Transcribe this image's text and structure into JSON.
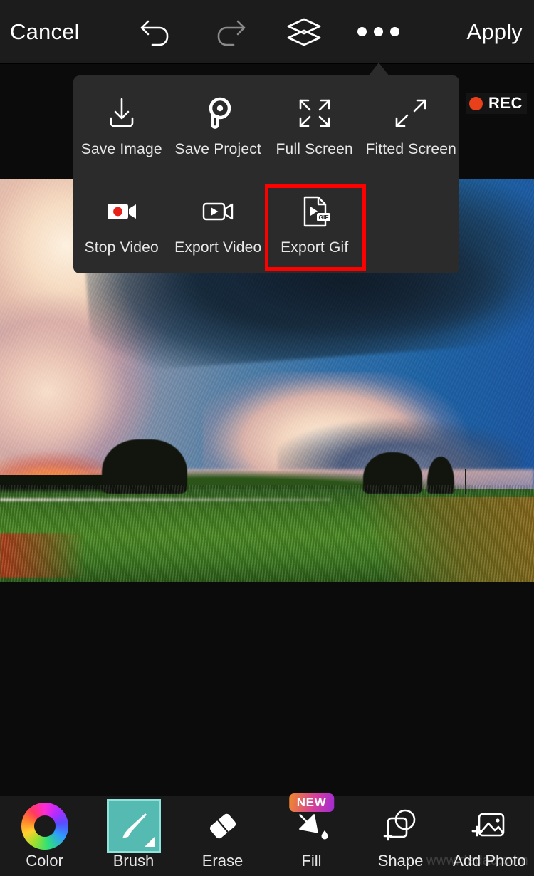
{
  "topbar": {
    "cancel_label": "Cancel",
    "apply_label": "Apply",
    "undo_icon": "undo-arrow-icon",
    "redo_icon": "redo-arrow-icon",
    "layers_icon": "layers-icon",
    "more_icon": "more-options-icon"
  },
  "rec": {
    "label": "REC",
    "dot_color": "#e8401a"
  },
  "menu": {
    "rows": [
      {
        "items": [
          {
            "label": "Save Image",
            "icon": "download-icon"
          },
          {
            "label": "Save Project",
            "icon": "picsart-logo-icon"
          },
          {
            "label": "Full Screen",
            "icon": "full-screen-icon"
          },
          {
            "label": "Fitted Screen",
            "icon": "fitted-screen-icon"
          }
        ]
      },
      {
        "items": [
          {
            "label": "Stop Video",
            "icon": "stop-video-icon"
          },
          {
            "label": "Export Video",
            "icon": "export-video-icon"
          },
          {
            "label": "Export Gif",
            "icon": "export-gif-icon"
          }
        ]
      }
    ],
    "highlight": {
      "target": "Export Gif",
      "color": "#ff0000"
    }
  },
  "toolbar": {
    "tools": [
      {
        "label": "Color",
        "icon": "color-wheel-icon",
        "selected": false,
        "badge": ""
      },
      {
        "label": "Brush",
        "icon": "brush-icon",
        "selected": true,
        "badge": ""
      },
      {
        "label": "Erase",
        "icon": "eraser-icon",
        "selected": false,
        "badge": ""
      },
      {
        "label": "Fill",
        "icon": "paint-bucket-icon",
        "selected": false,
        "badge": "NEW"
      },
      {
        "label": "Shape",
        "icon": "add-shape-icon",
        "selected": false,
        "badge": ""
      },
      {
        "label": "Add Photo",
        "icon": "add-photo-icon",
        "selected": false,
        "badge": ""
      }
    ],
    "selected_color": "#55bab1",
    "selected_border_color": "#8fe3da"
  },
  "canvas": {
    "artwork_description": "Stylized painterly landscape photo with dramatic storm clouds, sunset glow and green field"
  },
  "watermark": {
    "text": "www.dedaq.com"
  }
}
